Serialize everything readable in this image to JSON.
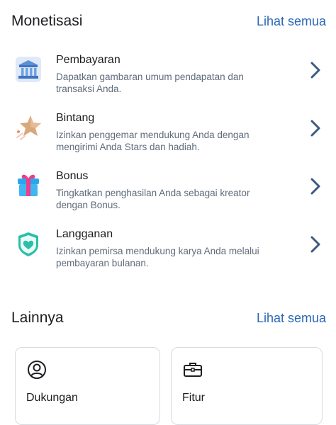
{
  "monetization": {
    "title": "Monetisasi",
    "see_all": "Lihat semua",
    "items": [
      {
        "title": "Pembayaran",
        "desc": "Dapatkan gambaran umum pendapatan dan transaksi Anda.",
        "icon": "bank-icon"
      },
      {
        "title": "Bintang",
        "desc": "Izinkan penggemar mendukung Anda dengan mengirimi Anda Stars dan hadiah.",
        "icon": "star-icon"
      },
      {
        "title": "Bonus",
        "desc": "Tingkatkan penghasilan Anda sebagai kreator dengan Bonus.",
        "icon": "gift-icon"
      },
      {
        "title": "Langganan",
        "desc": "Izinkan pemirsa mendukung karya Anda melalui pembayaran bulanan.",
        "icon": "heart-shield-icon"
      }
    ]
  },
  "others": {
    "title": "Lainnya",
    "see_all": "Lihat semua",
    "cards": [
      {
        "label": "Dukungan",
        "icon": "user-circle-icon"
      },
      {
        "label": "Fitur",
        "icon": "briefcase-icon"
      }
    ]
  },
  "colors": {
    "accent": "#2a67b5",
    "text": "#1c1e21",
    "secondary_text": "#5f6b7a",
    "chevron": "#3d5a80"
  }
}
